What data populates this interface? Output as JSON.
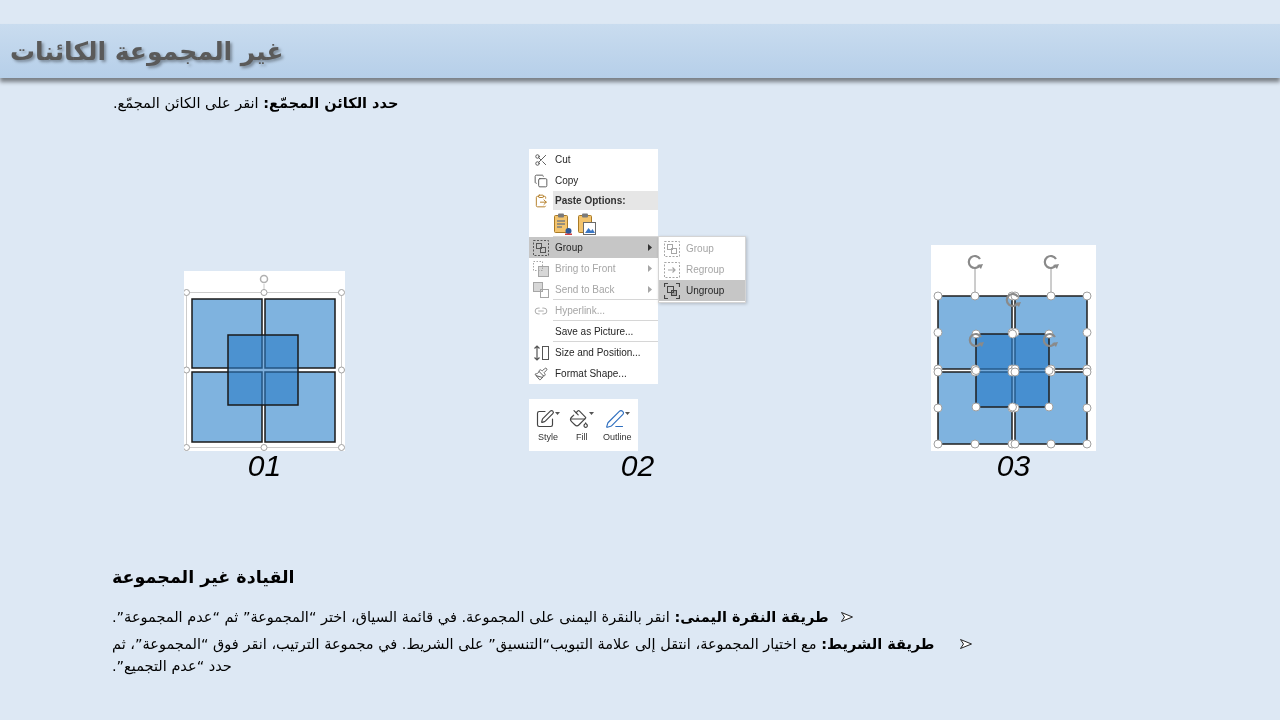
{
  "title": "غير المجموعة الكائنات",
  "instruction": "**حدد الكائن المجمّع:** انقر على الكائن المجمّع.",
  "figures": [
    {
      "kind": "ungrouped",
      "caption": "03"
    },
    {
      "kind": "menu",
      "caption": "02",
      "menu": [
        {
          "kind": "item",
          "label": "Cut",
          "disabled": false,
          "selected": false,
          "submenu": false,
          "divider": false
        },
        {
          "kind": "item",
          "label": "Copy",
          "disabled": false,
          "selected": false,
          "submenu": false,
          "divider": false
        },
        {
          "kind": "header",
          "label": "Paste Options:",
          "divider": false
        },
        {
          "kind": "paste-row",
          "divider": true
        },
        {
          "kind": "item",
          "label": "Group",
          "disabled": false,
          "selected": true,
          "submenu": true,
          "divider": false
        },
        {
          "kind": "item",
          "label": "Bring to Front",
          "disabled": true,
          "selected": false,
          "submenu": true,
          "divider": false
        },
        {
          "kind": "item",
          "label": "Send to Back",
          "disabled": true,
          "selected": false,
          "submenu": true,
          "divider": true
        },
        {
          "kind": "item",
          "label": "Hyperlink...",
          "disabled": true,
          "selected": false,
          "submenu": false,
          "divider": true
        },
        {
          "kind": "item",
          "label": "Save as Picture...",
          "disabled": false,
          "selected": false,
          "submenu": false,
          "divider": true
        },
        {
          "kind": "item",
          "label": "Size and Position...",
          "disabled": false,
          "selected": false,
          "submenu": false,
          "divider": false
        },
        {
          "kind": "item",
          "label": "Format Shape...",
          "disabled": false,
          "selected": false,
          "submenu": false,
          "divider": false
        }
      ],
      "submenu": [
        {
          "label": "Group",
          "disabled": true,
          "selected": false
        },
        {
          "label": "Regroup",
          "disabled": true,
          "selected": false
        },
        {
          "label": "Ungroup",
          "disabled": false,
          "selected": true
        }
      ],
      "toolbar": [
        {
          "label": "Outline"
        },
        {
          "label": "Fill"
        },
        {
          "label": "Style"
        }
      ]
    },
    {
      "kind": "grouped",
      "caption": "01"
    }
  ],
  "section": {
    "heading": "القيادة غير المجموعة",
    "methods": [
      "**طريقة النقرة اليمنى:** انقر بالنقرة اليمنى على المجموعة. في قائمة السياق، اختر “المجموعة” ثم “عدم المجموعة”.",
      "**طريقة الشريط:** مع اختيار المجموعة، انتقل إلى علامة التبويب“التنسيق” على الشريط. في مجموعة الترتيب، انقر فوق “المجموعة”، ثم حدد “عدم التجميع”."
    ]
  }
}
